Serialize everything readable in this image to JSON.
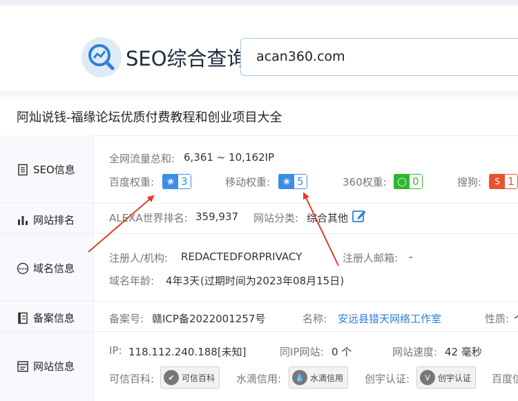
{
  "header": {
    "brand": "SEO综合查询",
    "search_value": "acan360.com",
    "logo_icon": "chart-magnifier-icon"
  },
  "site_title": "阿灿说钱-福缘论坛优质付费教程和创业项目大全",
  "rows": {
    "seo": {
      "label": "SEO信息",
      "traffic_label": "全网流量总和:",
      "traffic_value": "6,361 ~ 10,162IP",
      "baidu_label": "百度权重:",
      "baidu_value": "3",
      "mobile_label": "移动权重:",
      "mobile_value": "5",
      "q360_label": "360权重:",
      "q360_value": "0",
      "sogou_label": "搜狗:",
      "sogou_value": "1"
    },
    "rank": {
      "label": "网站排名",
      "alexa_label": "ALEXA世界排名:",
      "alexa_value": "359,937",
      "category_label": "网站分类:",
      "category_value": "综合其他"
    },
    "domain": {
      "label": "域名信息",
      "registrant_label": "注册人/机构:",
      "registrant_value": "REDACTEDFORPRIVACY",
      "email_label": "注册人邮箱:",
      "email_value": "-",
      "age_label": "域名年龄:",
      "age_value": "4年3天",
      "expiry": "(过期时间为2023年08月15日)"
    },
    "icp": {
      "label": "备案信息",
      "number_label": "备案号:",
      "number_value": "赣ICP备2022001257号",
      "name_label": "名称:",
      "name_value": "安远县猎天网络工作室",
      "nature_label": "性质:",
      "nature_value": "个"
    },
    "web": {
      "label": "网站信息",
      "ip_label": "IP:",
      "ip_value": "118.112.240.188[未知]",
      "sameip_label": "同IP网站:",
      "sameip_value": "0 个",
      "speed_label": "网站速度:",
      "speed_value": "42 毫秒",
      "kexin_label": "可信百科:",
      "kexin_seal": "可信百科",
      "shuidi_label": "水滴信用:",
      "shuidi_seal": "水滴信用",
      "chuangyu_label": "创宇认证:",
      "chuangyu_seal": "创宇认证",
      "baidu_label": "百度信"
    }
  },
  "colors": {
    "accent_blue": "#3b8ee8",
    "annotation_red": "#e03a2a",
    "green": "#2eb82e",
    "red": "#e8542e"
  }
}
